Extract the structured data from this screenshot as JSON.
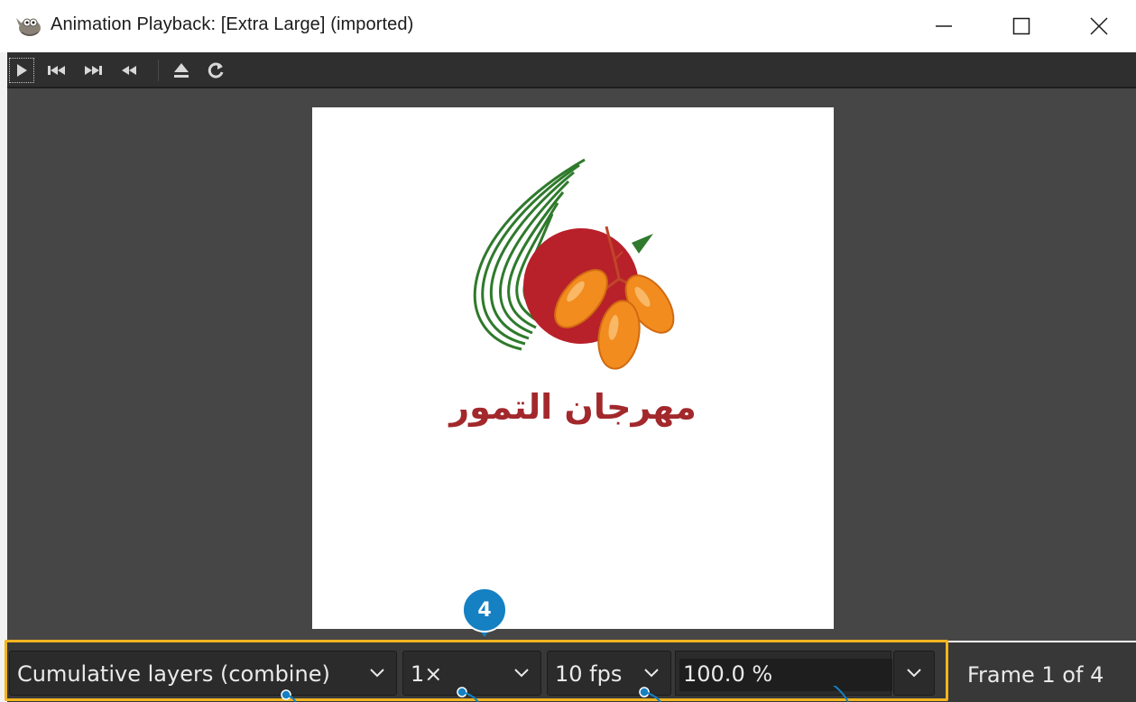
{
  "window": {
    "title": "Animation Playback: [Extra Large] (imported)",
    "controls": [
      "minimize-icon",
      "maximize-icon",
      "close-icon"
    ]
  },
  "toolbar": {
    "buttons": [
      "play-icon",
      "first-frame-icon",
      "last-frame-icon",
      "rewind-icon",
      "eject-icon",
      "refresh-icon"
    ]
  },
  "image": {
    "logo_text": "مهرجان التمور",
    "colors": {
      "red": "#b8202a",
      "orange": "#f28c1e",
      "green": "#2f7a2c",
      "text": "#a2282c"
    }
  },
  "bottom_bar": {
    "mode": "Cumulative layers (combine)",
    "speed": "1×",
    "fps": "10 fps",
    "zoom": "100.0 %",
    "frame_status": "Frame 1 of 4"
  },
  "callout": {
    "number": "4",
    "highlight_color": "#f2b51f",
    "badge_color": "#1580c2"
  }
}
